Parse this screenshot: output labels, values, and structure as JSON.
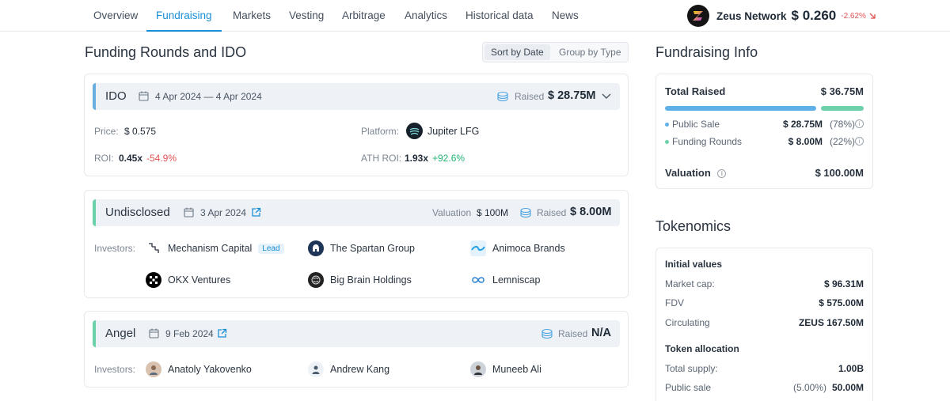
{
  "nav": {
    "tabs": [
      "Overview",
      "Fundraising",
      "Markets",
      "Vesting",
      "Arbitrage",
      "Analytics",
      "Historical data",
      "News"
    ],
    "active_tab": "Fundraising"
  },
  "token": {
    "name": "Zeus Network",
    "price": "$ 0.260",
    "change": "-2.62%"
  },
  "funding": {
    "title": "Funding Rounds and IDO",
    "sort_by_date": "Sort by Date",
    "group_by_type": "Group by Type",
    "rounds": [
      {
        "type": "IDO",
        "date": "4 Apr 2024 — 4 Apr 2024",
        "raised_label": "Raised",
        "raised": "$ 28.75M",
        "price_label": "Price:",
        "price": "$ 0.575",
        "platform_label": "Platform:",
        "platform": "Jupiter LFG",
        "roi_label": "ROI:",
        "roi": "0.45x",
        "roi_change": "-54.9%",
        "ath_roi_label": "ATH ROI:",
        "ath_roi": "1.93x",
        "ath_roi_change": "+92.6%",
        "accent": "#6aaee0"
      },
      {
        "type": "Undisclosed",
        "date": "3 Apr 2024",
        "valuation_label": "Valuation",
        "valuation": "$ 100M",
        "raised_label": "Raised",
        "raised": "$ 8.00M",
        "investors_label": "Investors:",
        "investors": [
          "Mechanism Capital",
          "The Spartan Group",
          "Animoca Brands",
          "OKX Ventures",
          "Big Brain Holdings",
          "Lemniscap"
        ],
        "lead_label": "Lead",
        "accent": "#6cd0a8"
      },
      {
        "type": "Angel",
        "date": "9 Feb 2024",
        "raised_label": "Raised",
        "raised": "N/A",
        "investors_label": "Investors:",
        "investors": [
          "Anatoly Yakovenko",
          "Andrew Kang",
          "Muneeb Ali"
        ],
        "accent": "#6cd0a8"
      }
    ]
  },
  "fundraising_info": {
    "title": "Fundraising Info",
    "total_raised_label": "Total Raised",
    "total_raised": "$ 36.75M",
    "public_sale_label": "Public Sale",
    "public_sale": "$ 28.75M",
    "public_sale_pct": "(78%)",
    "funding_rounds_label": "Funding Rounds",
    "funding_rounds": "$ 8.00M",
    "funding_rounds_pct": "(22%)",
    "public_sale_share": 0.78,
    "valuation_label": "Valuation",
    "valuation": "$ 100.00M",
    "colors": {
      "public_sale": "#5fb0e6",
      "funding_rounds": "#6cd0a8"
    }
  },
  "tokenomics": {
    "title": "Tokenomics",
    "initial_values_label": "Initial values",
    "market_cap_label": "Market cap:",
    "market_cap": "$ 96.31M",
    "fdv_label": "FDV",
    "fdv": "$ 575.00M",
    "circulating_label": "Circulating",
    "circulating": "ZEUS 167.50M",
    "token_allocation_label": "Token allocation",
    "total_supply_label": "Total supply:",
    "total_supply": "1.00B",
    "public_sale_label": "Public sale",
    "public_sale_pct": "(5.00%)",
    "public_sale": "50.00M"
  }
}
